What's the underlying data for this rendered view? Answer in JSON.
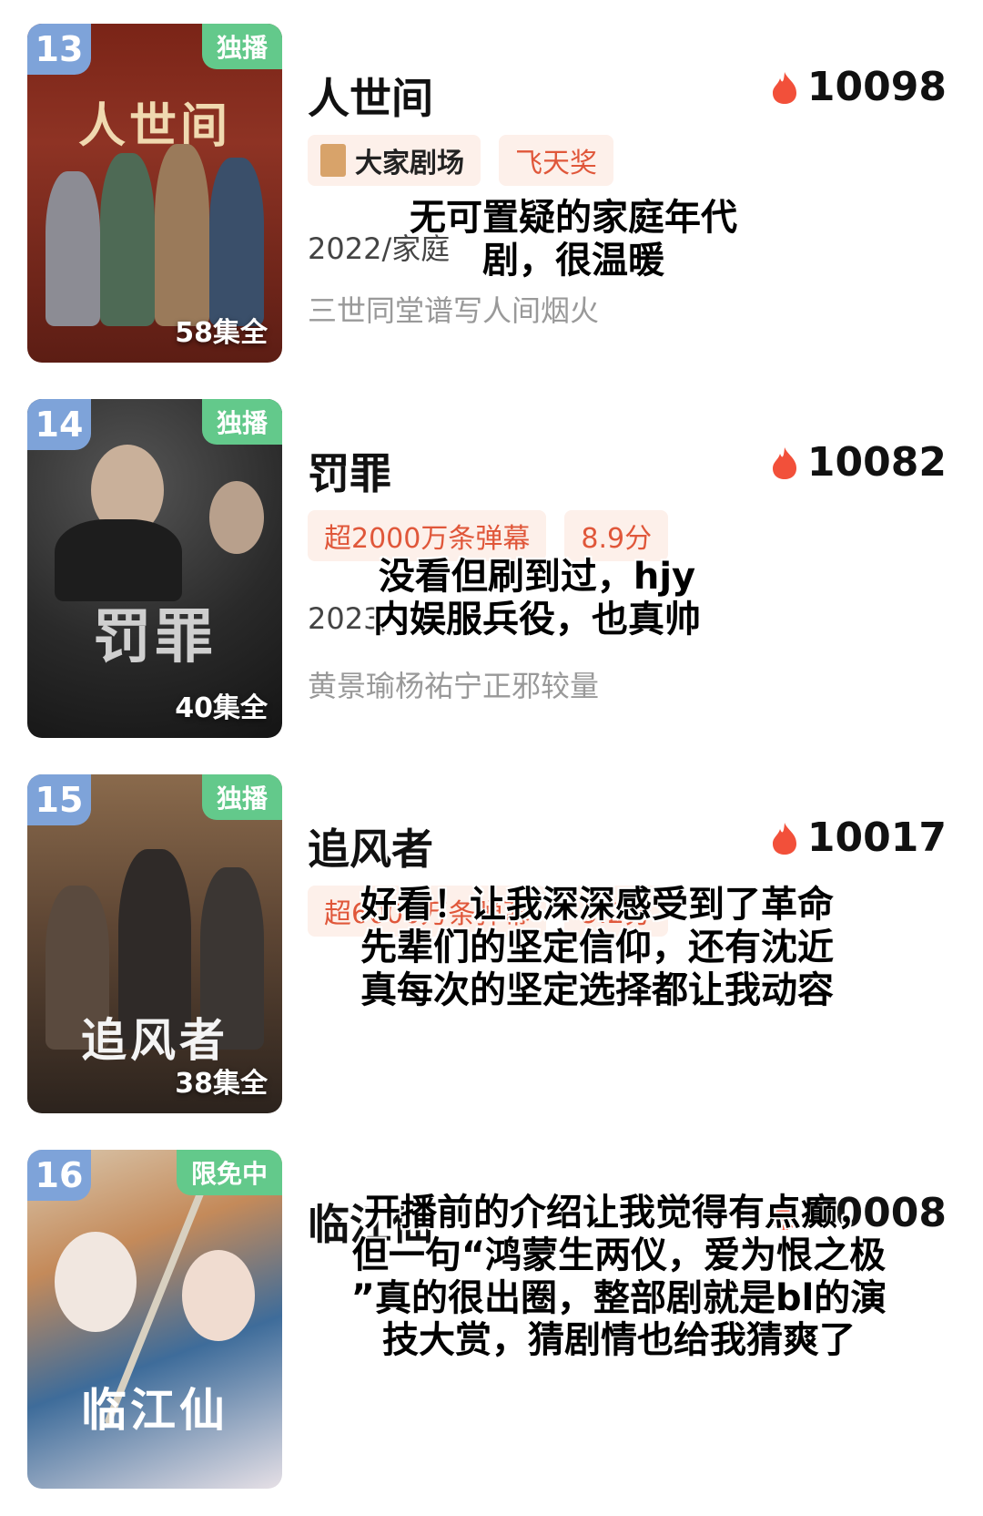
{
  "items": [
    {
      "rank": "13",
      "badge": "独播",
      "episodes": "58集全",
      "poster_title": "人世间",
      "title": "人世间",
      "heat": "10098",
      "tags": [
        "大家剧场",
        "飞天奖"
      ],
      "meta": "2022/家庭",
      "desc": "三世同堂谱写人间烟火",
      "comment": [
        "无可置疑的家庭年代",
        "剧，很温暖"
      ]
    },
    {
      "rank": "14",
      "badge": "独播",
      "episodes": "40集全",
      "poster_title": "罚罪",
      "title": "罚罪",
      "heat": "10082",
      "tags": [
        "超2000万条弹幕",
        "8.9分"
      ],
      "meta": "2023/",
      "desc": "黄景瑜杨祐宁正邪较量",
      "comment": [
        "没看但刷到过，hjy",
        "内娱服兵役，也真帅"
      ]
    },
    {
      "rank": "15",
      "badge": "独播",
      "episodes": "38集全",
      "poster_title": "追风者",
      "title": "追风者",
      "heat": "10017",
      "tags": [
        "超6000万条弹幕",
        "9.2分"
      ],
      "meta": "",
      "desc": "",
      "comment": [
        "好看！让我深深感受到了革命",
        "先辈们的坚定信仰，还有沈近",
        "真每次的坚定选择都让我动容"
      ]
    },
    {
      "rank": "16",
      "badge": "限免中",
      "episodes": "",
      "poster_title": "临江仙",
      "title": "临江仙",
      "heat": "10008",
      "tags": [],
      "meta": "",
      "desc": "",
      "comment": [
        "开播前的介绍让我觉得有点癫，",
        "但一句“鸿蒙生两仪，爱为恨之极",
        "”真的很出圈，整部剧就是bl的演",
        "技大赏，猜剧情也给我猜爽了"
      ]
    }
  ],
  "colors": {
    "rank_bg": "#7ea3d9",
    "badge_bg": "#63c98b",
    "tag_bg": "#fdf0ea",
    "tag_text": "#e0573a",
    "flame": "#f2503a"
  },
  "icons": {
    "heat": "flame-icon",
    "theater": "theater-logo-icon"
  }
}
